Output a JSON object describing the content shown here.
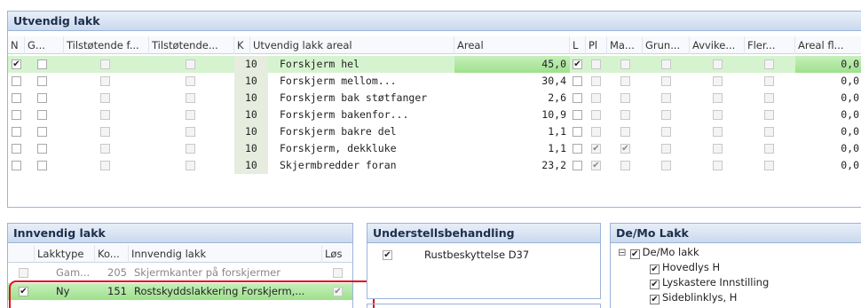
{
  "utvendig": {
    "title": "Utvendig lakk",
    "headers": [
      "N",
      "G...",
      "Tilstøtende f...",
      "Tilstøtende...",
      "K",
      "Utvendig lakk areal",
      "Areal",
      "L",
      "Pl",
      "Ma...",
      "Grun...",
      "Avvike...",
      "Fler...",
      "Areal fl..."
    ],
    "rows": [
      {
        "k": "10",
        "name": "Forskjerm hel",
        "areal": "45,0",
        "arealfl": "0,0",
        "n": true,
        "l": true,
        "pl": false,
        "ma": false,
        "selected": true
      },
      {
        "k": "10",
        "name": "Forskjerm mellom...",
        "areal": "30,4",
        "arealfl": "0,0",
        "n": false,
        "l": false,
        "pl": false,
        "ma": false,
        "selected": false
      },
      {
        "k": "10",
        "name": "Forskjerm bak støtfanger",
        "areal": "2,6",
        "arealfl": "0,0",
        "n": false,
        "l": false,
        "pl": false,
        "ma": false,
        "selected": false
      },
      {
        "k": "10",
        "name": "Forskjerm bakenfor...",
        "areal": "10,9",
        "arealfl": "0,0",
        "n": false,
        "l": false,
        "pl": false,
        "ma": false,
        "selected": false
      },
      {
        "k": "10",
        "name": "Forskjerm bakre del",
        "areal": "1,1",
        "arealfl": "0,0",
        "n": false,
        "l": false,
        "pl": false,
        "ma": false,
        "selected": false
      },
      {
        "k": "10",
        "name": "Forskjerm, dekkluke",
        "areal": "1,1",
        "arealfl": "0,0",
        "n": false,
        "l": false,
        "pl": true,
        "ma": true,
        "selected": false
      },
      {
        "k": "10",
        "name": "Skjermbredder foran",
        "areal": "23,2",
        "arealfl": "0,0",
        "n": false,
        "l": false,
        "pl": true,
        "ma": false,
        "selected": false
      }
    ]
  },
  "innvendig": {
    "title": "Innvendig lakk",
    "headers": [
      "Lakktype",
      "Ko...",
      "Innvendig lakk",
      "Løs"
    ],
    "rows": [
      {
        "checked": false,
        "type": "Gam...",
        "code": "205",
        "name": "Skjermkanter på forskjermer",
        "los": false,
        "highlight": false
      },
      {
        "checked": true,
        "type": "Ny",
        "code": "151",
        "name": "Rostskyddslakkering Forskjerm,...",
        "los": true,
        "highlight": true
      }
    ]
  },
  "understell": {
    "title": "Understellsbehandling",
    "rows": [
      {
        "checked": true,
        "name": "Rustbeskyttelse D37"
      }
    ]
  },
  "demo": {
    "title": "De/Mo Lakk",
    "root": "De/Mo lakk",
    "collapse_symbol": "⊟",
    "items": [
      "Hovedlys H",
      "Lyskastere Innstilling",
      "Sideblinklys, H"
    ]
  },
  "colors": {
    "panel_border": "#9cb4d8",
    "selection_green": "#9ee08c",
    "highlight_red": "#e0101a"
  }
}
